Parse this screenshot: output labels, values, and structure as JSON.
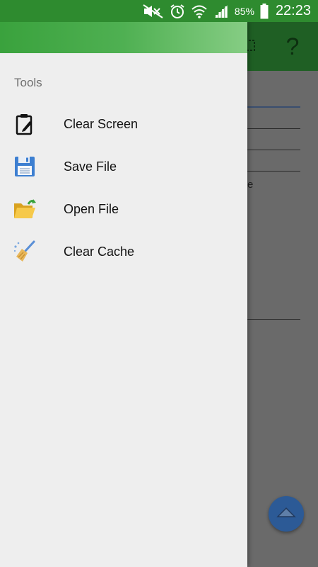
{
  "status_bar": {
    "battery_percent": "85%",
    "time": "22:23",
    "icons": [
      "mute-icon",
      "alarm-icon",
      "wifi-icon",
      "signal-icon",
      "battery-icon"
    ]
  },
  "drawer": {
    "section_title": "Tools",
    "items": [
      {
        "label": "Clear Screen",
        "icon": "clear-screen-icon"
      },
      {
        "label": "Save File",
        "icon": "floppy-disk-icon"
      },
      {
        "label": "Open File",
        "icon": "open-folder-icon"
      },
      {
        "label": "Clear Cache",
        "icon": "broom-icon"
      }
    ]
  },
  "background_app": {
    "toolbar_icons": [
      "grid-icon",
      "help-icon"
    ],
    "peek_text": "e"
  },
  "colors": {
    "status_bar": "#2e8b2f",
    "drawer_header_start": "#3aa23d",
    "drawer_header_end": "#86cd84",
    "fab": "#2c5a96"
  }
}
